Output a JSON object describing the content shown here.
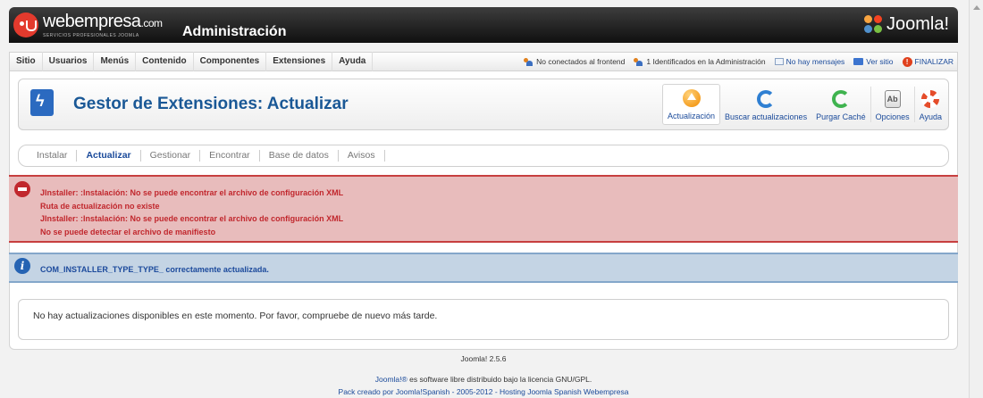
{
  "header": {
    "brand_main": "webempresa",
    "brand_suffix": ".com",
    "brand_tagline": "SERVICIOS PROFESIONALES JOOMLA",
    "title": "Administración",
    "joomla_word": "Joomla!"
  },
  "menu": {
    "items": [
      {
        "label": "Sitio"
      },
      {
        "label": "Usuarios"
      },
      {
        "label": "Menús"
      },
      {
        "label": "Contenido"
      },
      {
        "label": "Componentes"
      },
      {
        "label": "Extensiones"
      },
      {
        "label": "Ayuda"
      }
    ]
  },
  "status": {
    "frontend": "No conectados al frontend",
    "admin": "1 Identificados en la Administración",
    "messages": "No hay mensajes",
    "view_site": "Ver sitio",
    "logout": "FINALIZAR"
  },
  "toolbar": {
    "page_title": "Gestor de Extensiones: Actualizar",
    "buttons": [
      {
        "label": "Actualización",
        "icon": "update-icon"
      },
      {
        "label": "Buscar actualizaciones",
        "icon": "refresh-icon"
      },
      {
        "label": "Purgar Caché",
        "icon": "purge-icon"
      },
      {
        "label": "Opciones",
        "icon": "options-icon"
      },
      {
        "label": "Ayuda",
        "icon": "help-icon"
      }
    ]
  },
  "subnav": {
    "tabs": [
      {
        "label": "Instalar"
      },
      {
        "label": "Actualizar"
      },
      {
        "label": "Gestionar"
      },
      {
        "label": "Encontrar"
      },
      {
        "label": "Base de datos"
      },
      {
        "label": "Avisos"
      }
    ],
    "active": "Actualizar"
  },
  "messages": {
    "errors": [
      "JInstaller: :Instalación: No se puede encontrar el archivo de configuración XML",
      "Ruta de actualización no existe",
      "JInstaller: :Instalación: No se puede encontrar el archivo de configuración XML",
      "No se puede detectar el archivo de manifiesto"
    ],
    "info": "COM_INSTALLER_TYPE_TYPE_ correctamente actualizada."
  },
  "content": {
    "no_updates": "No hay actualizaciones disponibles en este momento. Por favor, compruebe de nuevo más tarde."
  },
  "footer": {
    "version": "Joomla! 2.5.6",
    "license_link": "Joomla!®",
    "license_text": " es software libre distribuido bajo la licencia GNU/GPL.",
    "credit": "Pack creado por Joomla!Spanish - 2005-2012 - Hosting Joomla Spanish Webempresa"
  },
  "colors": {
    "title_blue": "#1a5896",
    "error_red": "#c1272d",
    "error_bg": "#e8bcbc",
    "info_bg": "#c4d4e4",
    "link_blue": "#1a4a9a"
  }
}
